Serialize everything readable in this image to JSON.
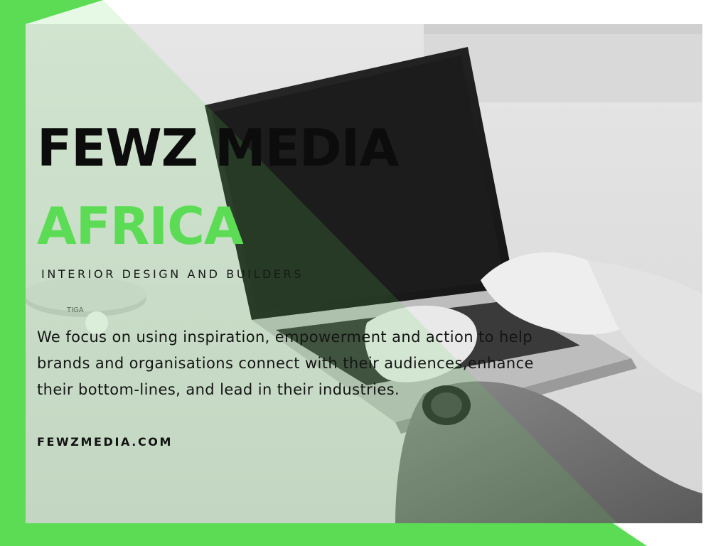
{
  "brand": {
    "name_line1": "FEWZ MEDIA",
    "name_line2": "AFRICA",
    "tagline": "INTERIOR DESIGN AND BUILDERS"
  },
  "description": {
    "line1": "We focus on using inspiration, empowerment and action to help",
    "line2": "brands and organisations connect with their audiences,enhance",
    "line3": "their bottom-lines, and lead in their industries."
  },
  "footer": {
    "website": "FEWZMEDIA.COM"
  },
  "photo": {
    "ping_pong_paddle_brand": "TIGA"
  },
  "colors": {
    "accent_green": "#5cdc55",
    "title_dark": "#0c0c0c",
    "frame_white": "#ffffff"
  }
}
